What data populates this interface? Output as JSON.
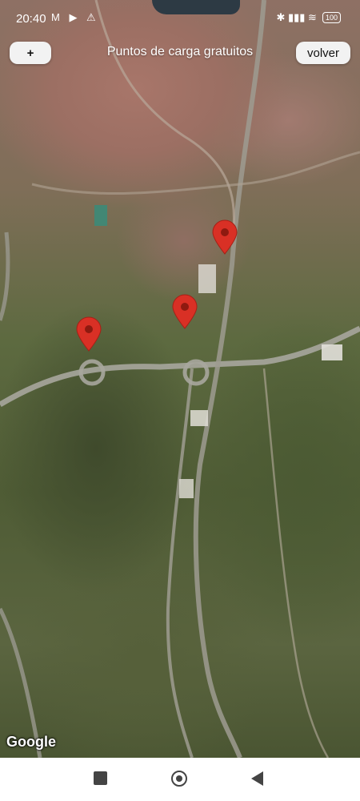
{
  "status_bar": {
    "time": "20:40",
    "left_icons": "M ▶ ⚠",
    "right_icons": "✱ ▮▮▮ ≋",
    "battery": "100"
  },
  "header": {
    "title": "Puntos de carga gratuitos",
    "add_label": "+",
    "back_label": "volver"
  },
  "map": {
    "attribution": "Google",
    "marker_color": "#d93025",
    "markers": [
      {
        "name": "charging-point-1"
      },
      {
        "name": "charging-point-2"
      },
      {
        "name": "charging-point-3"
      }
    ]
  },
  "nav_bar": {
    "icons": [
      "recent-apps-icon",
      "home-icon",
      "back-icon"
    ]
  }
}
